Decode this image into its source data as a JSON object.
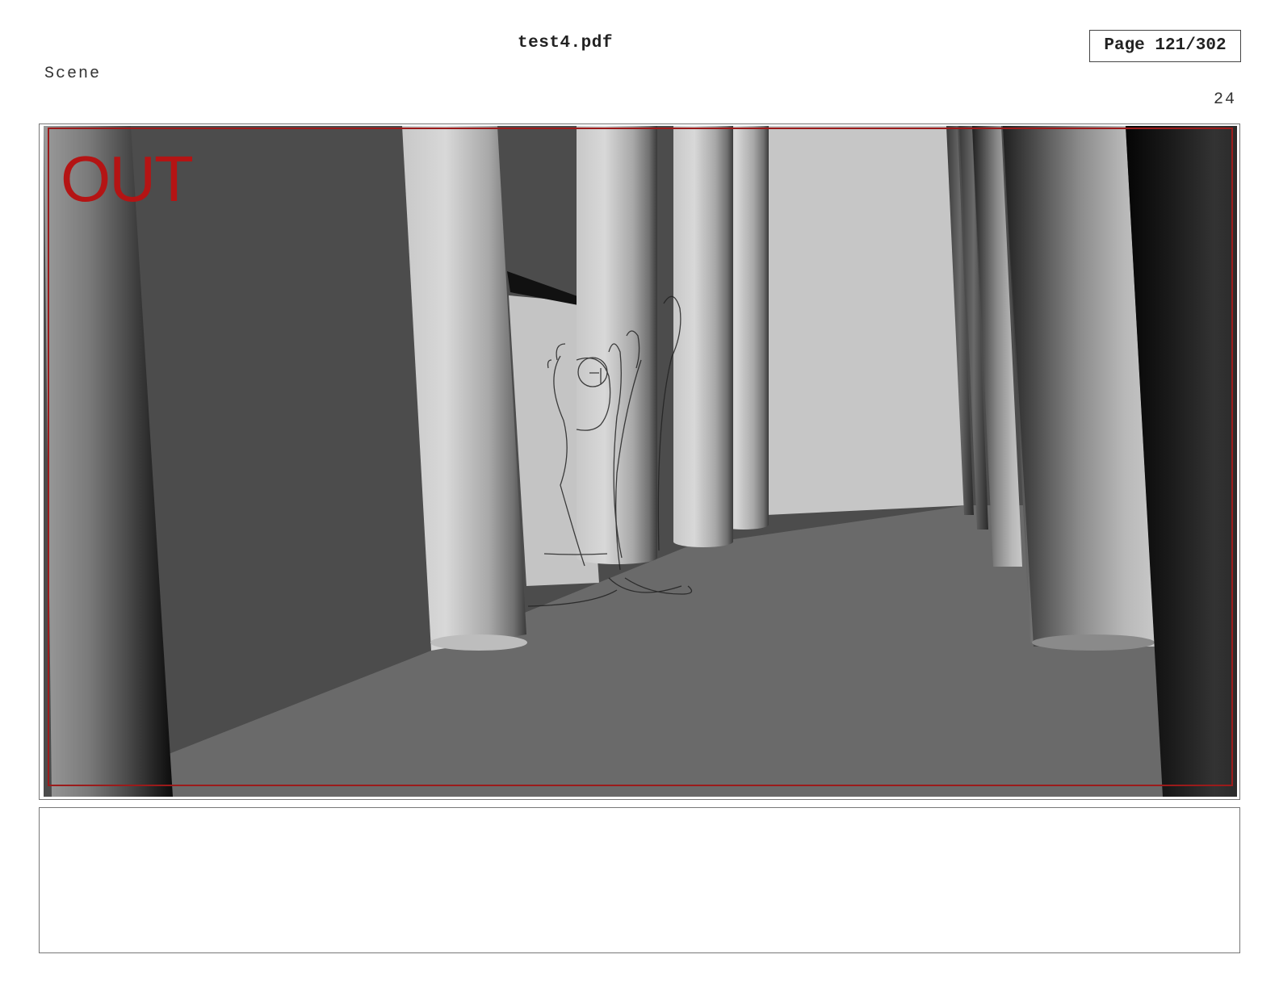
{
  "header": {
    "document_title": "test4.pdf",
    "page_indicator": "Page 121/302",
    "scene_label": "Scene",
    "scene_number": "24"
  },
  "panel": {
    "overlay_text": "OUT",
    "overlay_color": "#b41414",
    "safe_frame_color": "#9b1b1b"
  },
  "notes": {
    "text": ""
  }
}
